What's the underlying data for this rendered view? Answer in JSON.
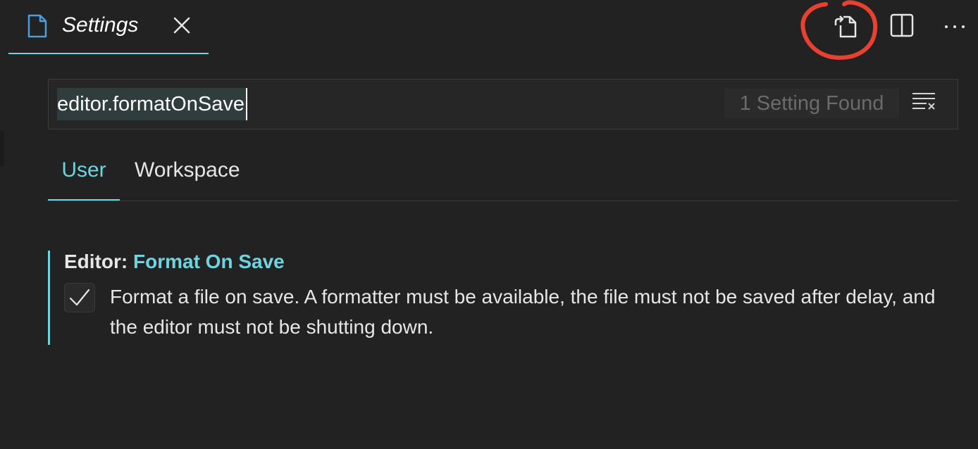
{
  "tab": {
    "title": "Settings",
    "icon": "file-icon",
    "close_icon": "close-icon"
  },
  "toolbar": {
    "open_json_icon": "open-settings-json-icon",
    "split_icon": "split-editor-icon",
    "more_icon": "more-actions-icon"
  },
  "annotation": {
    "color": "#e8412f"
  },
  "search": {
    "value": "editor.formatOnSave",
    "count": "1 Setting Found",
    "clear_icon": "clear-filter-icon"
  },
  "scopes": {
    "user": "User",
    "workspace": "Workspace",
    "active": "User"
  },
  "setting": {
    "category": "Editor: ",
    "name": "Format On Save",
    "checked": true,
    "description": "Format a file on save. A formatter must be available, the file must not be saved after delay, and the editor must not be shutting down."
  },
  "colors": {
    "accent": "#6fd3e0",
    "background": "#222222",
    "tab_icon": "#4f9bdc"
  }
}
